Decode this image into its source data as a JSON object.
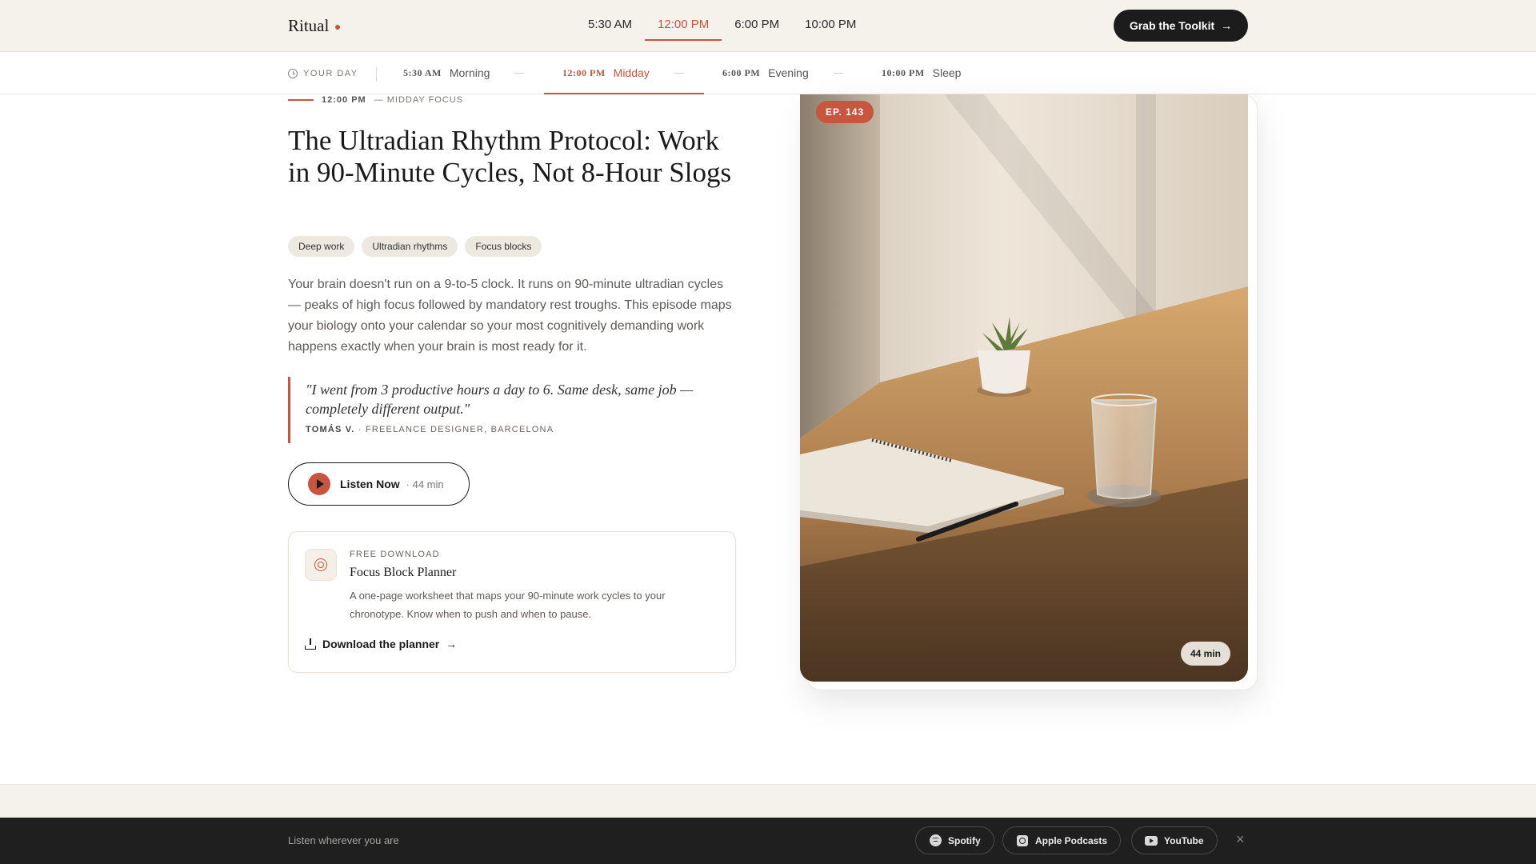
{
  "header": {
    "logo": "Ritual",
    "nav": [
      "5:30 AM",
      "12:00 PM",
      "6:00 PM",
      "10:00 PM"
    ],
    "active_nav": "12:00 PM",
    "cta_label": "Grab the Toolkit",
    "cta_icon": "arrow-right-icon"
  },
  "day_strip": {
    "label": "YOUR DAY",
    "items": [
      {
        "time": "5:30 AM",
        "label": "Morning"
      },
      {
        "time": "12:00 PM",
        "label": "Midday"
      },
      {
        "time": "6:00 PM",
        "label": "Evening"
      },
      {
        "time": "10:00 PM",
        "label": "Sleep"
      }
    ],
    "active": "Midday"
  },
  "episode": {
    "kicker_time": "12:00 PM",
    "kicker_label": "— MIDDAY FOCUS",
    "title": "The Ultradian Rhythm Protocol: Work in 90-Minute Cycles, Not 8-Hour Slogs",
    "tags": [
      "Deep work",
      "Ultradian rhythms",
      "Focus blocks"
    ],
    "description": "Your brain doesn't run on a 9-to-5 clock. It runs on 90-minute ultradian cycles — peaks of high focus followed by mandatory rest troughs. This episode maps your biology onto your calendar so your most cognitively demanding work happens exactly when your brain is most ready for it.",
    "quote": {
      "text": "\"I went from 3 productive hours a day to 6. Same desk, same job — completely different output.\"",
      "name": "TOMÁS V.",
      "role": "· FREELANCE DESIGNER, BARCELONA"
    },
    "listen": {
      "label": "Listen Now",
      "duration": "· 44 min"
    },
    "badge": "EP. 143",
    "image_duration": "44 min"
  },
  "download_card": {
    "kicker": "FREE DOWNLOAD",
    "title": "Focus Block Planner",
    "description": "A one-page worksheet that maps your 90-minute work cycles to your chronotype. Know when to push and when to pause.",
    "link": "Download the planner"
  },
  "bottom_bar": {
    "label": "Listen wherever you are",
    "platforms": [
      "Spotify",
      "Apple Podcasts",
      "YouTube"
    ],
    "close": "×"
  },
  "colors": {
    "accent": "#c8553d",
    "cream": "#f5f1eb",
    "dark": "#1f1f1f"
  }
}
